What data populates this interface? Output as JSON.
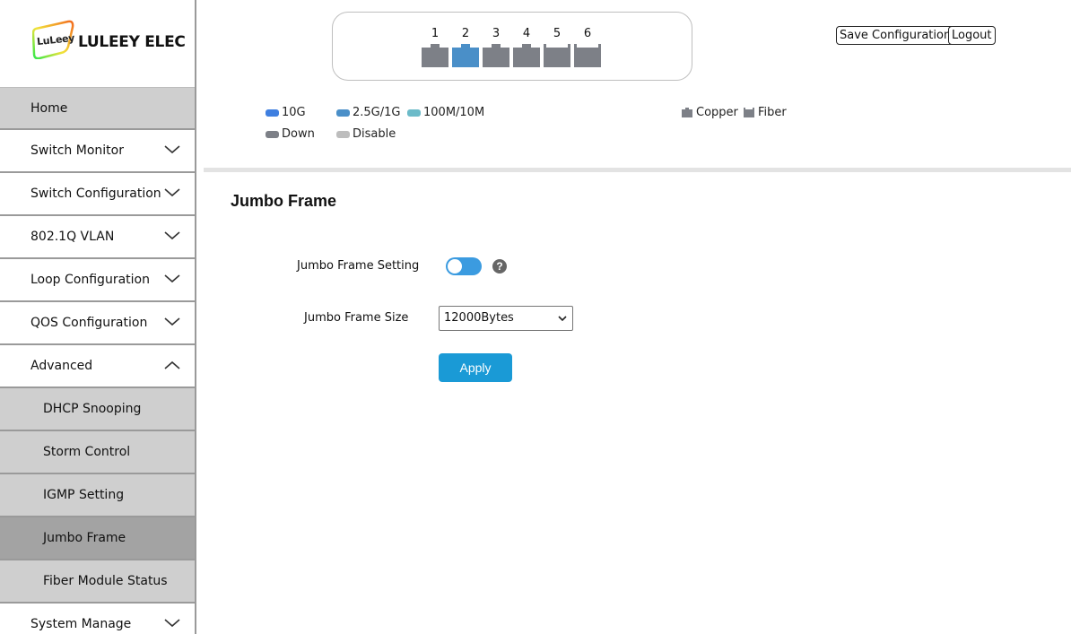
{
  "brand": {
    "badge_text": "LuLeey",
    "name": "LULEEY ELEC"
  },
  "sidebar": {
    "items": [
      {
        "label": "Home",
        "expandable": false
      },
      {
        "label": "Switch Monitor",
        "expandable": true,
        "expanded": false
      },
      {
        "label": "Switch Configuration",
        "expandable": true,
        "expanded": false
      },
      {
        "label": "802.1Q VLAN",
        "expandable": true,
        "expanded": false
      },
      {
        "label": "Loop Configuration",
        "expandable": true,
        "expanded": false
      },
      {
        "label": "QOS Configuration",
        "expandable": true,
        "expanded": false
      },
      {
        "label": "Advanced",
        "expandable": true,
        "expanded": true
      }
    ],
    "advanced_sub": [
      {
        "label": "DHCP Snooping"
      },
      {
        "label": "Storm Control"
      },
      {
        "label": "IGMP Setting"
      },
      {
        "label": "Jumbo Frame",
        "active": true
      },
      {
        "label": "Fiber Module Status"
      }
    ],
    "bottom_items": [
      {
        "label": "System Manage",
        "expandable": true,
        "expanded": false
      }
    ]
  },
  "ports": [
    {
      "num": "1",
      "type": "copper",
      "status": "down"
    },
    {
      "num": "2",
      "type": "copper",
      "status": "2.5G/1G"
    },
    {
      "num": "3",
      "type": "copper",
      "status": "down"
    },
    {
      "num": "4",
      "type": "copper",
      "status": "down"
    },
    {
      "num": "5",
      "type": "fiber",
      "status": "down"
    },
    {
      "num": "6",
      "type": "fiber",
      "status": "down"
    }
  ],
  "header": {
    "save_label": "Save Configuration",
    "logout_label": "Logout"
  },
  "legend": {
    "speeds": [
      {
        "label": "10G",
        "color": "#3f7fe0"
      },
      {
        "label": "2.5G/1G",
        "color": "#4a8fc8"
      },
      {
        "label": "100M/10M",
        "color": "#6cbbc9"
      },
      {
        "label": "Down",
        "color": "#7d8087"
      },
      {
        "label": "Disable",
        "color": "#bdbdbd"
      }
    ],
    "types": [
      {
        "label": "Copper",
        "icon": "copper-port-icon"
      },
      {
        "label": "Fiber",
        "icon": "fiber-port-icon"
      }
    ]
  },
  "colors": {
    "port_down": "#7d8087",
    "port_active": "#4a8fc8",
    "accent": "#1a9ad6",
    "toggle": "#3b9be0"
  },
  "page": {
    "title": "Jumbo Frame",
    "setting_label": "Jumbo Frame Setting",
    "setting_enabled": false,
    "size_label": "Jumbo Frame Size",
    "size_value": "12000Bytes",
    "help_glyph": "?",
    "apply_label": "Apply"
  }
}
